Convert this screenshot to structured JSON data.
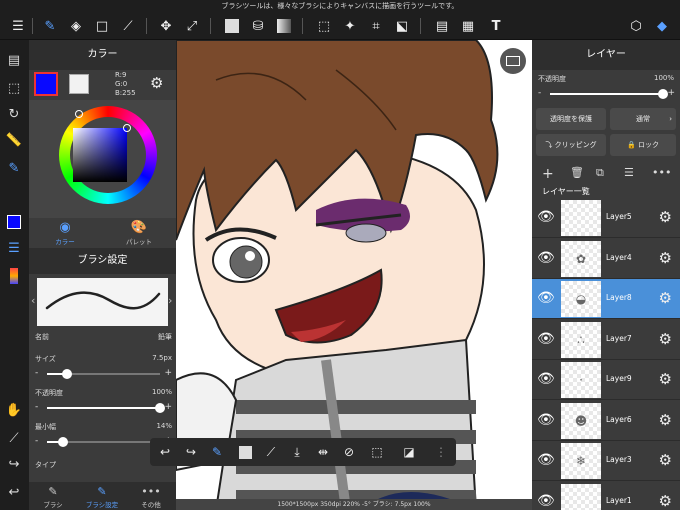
{
  "tip": "ブラシツールは、様々なブラシによりキャンバスに描画を行うツールです。",
  "colors": {
    "foreground": "#0909ff",
    "background": "#f2f2f2",
    "accent": "#4a90d9"
  },
  "color_panel": {
    "title": "カラー",
    "r": "R:9",
    "g": "G:0",
    "b": "B:255",
    "tab_color": "カラー",
    "tab_palette": "パレット"
  },
  "brush_panel": {
    "title": "ブラシ設定",
    "name_label": "名前",
    "name_value": "鉛筆",
    "size_label": "サイズ",
    "size_value": "7.5px",
    "size_level": 0.18,
    "opacity_label": "不透明度",
    "opacity_value": "100%",
    "opacity_level": 1.0,
    "min_width_label": "最小幅",
    "min_width_value": "14%",
    "min_width_level": 0.14,
    "type_label": "タイプ",
    "tab_brush": "ブラシ",
    "tab_brush_settings": "ブラシ設定",
    "tab_other": "その他"
  },
  "layer_panel": {
    "title": "レイヤー",
    "opacity_label": "不透明度",
    "opacity_value": "100%",
    "opacity_level": 1.0,
    "protect_alpha": "透明度を保護",
    "blend_mode": "通常",
    "clipping": "クリッピング",
    "lock": "ロック",
    "list_title": "レイヤー一覧",
    "layers": [
      {
        "name": "Layer5",
        "selected": false
      },
      {
        "name": "Layer4",
        "selected": false
      },
      {
        "name": "Layer8",
        "selected": true
      },
      {
        "name": "Layer7",
        "selected": false
      },
      {
        "name": "Layer9",
        "selected": false
      },
      {
        "name": "Layer6",
        "selected": false
      },
      {
        "name": "Layer3",
        "selected": false
      },
      {
        "name": "Layer1",
        "selected": false
      }
    ]
  },
  "status": "1500*1500px 350dpi 220% -5° ブラシ: 7.5px 100%"
}
